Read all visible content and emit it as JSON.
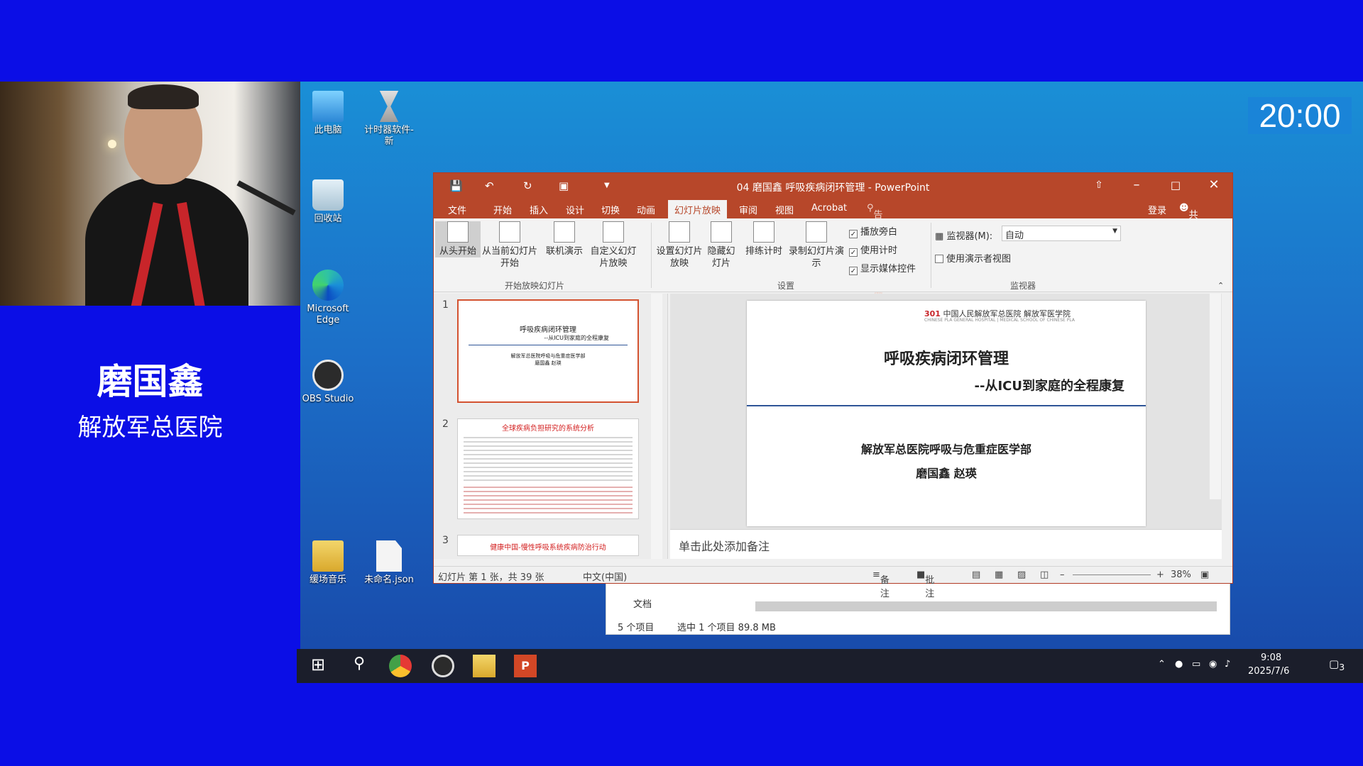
{
  "speaker": {
    "name": "磨国鑫",
    "org": "解放军总医院"
  },
  "timer": "20:00",
  "desktop_icons": [
    {
      "label": "此电脑",
      "icon": "computer-icon"
    },
    {
      "label": "计时器软件-新",
      "icon": "hourglass-icon"
    },
    {
      "label": "回收站",
      "icon": "recycle-bin-icon"
    },
    {
      "label": "Microsoft Edge",
      "icon": "edge-icon"
    },
    {
      "label": "OBS Studio",
      "icon": "obs-icon"
    },
    {
      "label": "缓场音乐",
      "icon": "folder-icon"
    },
    {
      "label": "未命名.json",
      "icon": "file-icon"
    }
  ],
  "ppt": {
    "title": "04 磨国鑫 呼吸疾病闭环管理 - PowerPoint",
    "menu": [
      "文件",
      "开始",
      "插入",
      "设计",
      "切换",
      "动画",
      "幻灯片放映",
      "审阅",
      "视图",
      "Acrobat"
    ],
    "tell_me": "告诉我你想要做什么...",
    "login": "登录",
    "share": "共享",
    "ribbon": {
      "buttons": [
        "从头开始",
        "从当前幻灯片开始",
        "联机演示",
        "自定义幻灯片放映",
        "设置幻灯片放映",
        "隐藏幻灯片",
        "排练计时",
        "录制幻灯片演示"
      ],
      "group_start": "开始放映幻灯片",
      "group_setup": "设置",
      "group_monitor": "监视器",
      "checkboxes": [
        "播放旁白",
        "使用计时",
        "显示媒体控件"
      ],
      "monitor_label": "监视器(M):",
      "monitor_value": "自动",
      "presenter_view": "使用演示者视图"
    },
    "thumbnails": [
      {
        "num": "1",
        "title": "呼吸疾病闭环管理",
        "subtitle": "--从ICU到家庭的全程康复",
        "line1": "解放军总医院呼吸与危重症医学部",
        "line2": "磨国鑫 赵瑛"
      },
      {
        "num": "2",
        "title": "全球疾病负担研究的系统分析"
      },
      {
        "num": "3",
        "title": "健康中国-慢性呼吸系统疾病防治行动"
      }
    ],
    "slide": {
      "org_logo": "301",
      "org_cn": "中国人民解放军总医院 解放军医学院",
      "org_en": "CHINESE PLA GENERAL HOSPITAL | MEDICAL SCHOOL OF CHINESE PLA",
      "title": "呼吸疾病闭环管理",
      "subtitle": "--从ICU到家庭的全程康复",
      "dept": "解放军总医院呼吸与危重症医学部",
      "authors": "磨国鑫 赵瑛"
    },
    "notes_placeholder": "单击此处添加备注",
    "status": {
      "slide_info": "幻灯片 第 1 张，共 39 张",
      "lang": "中文(中国)",
      "notes": "备注",
      "comments": "批注",
      "zoom": "38%"
    }
  },
  "explorer": {
    "item": "文档",
    "count": "5 个项目",
    "selected": "选中 1 个项目 89.8 MB"
  },
  "taskbar": {
    "time": "9:08",
    "date": "2025/7/6",
    "notif": "3"
  }
}
